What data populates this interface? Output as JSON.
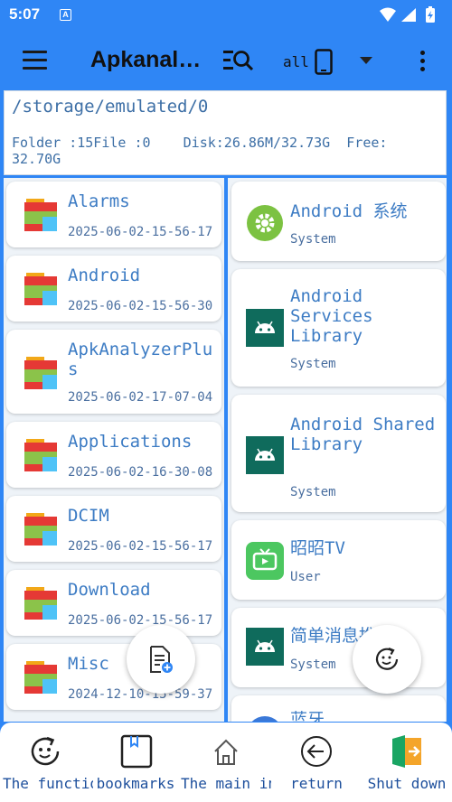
{
  "status_bar": {
    "time": "5:07",
    "notification_glyph": "A"
  },
  "app_bar": {
    "title": "Apkanaly…",
    "filter_label": "all"
  },
  "path_box": {
    "path": "/storage/emulated/0",
    "info": "Folder :15File :0    Disk:26.86M/32.73G  Free:\n32.70G"
  },
  "folders": [
    {
      "name": "Alarms",
      "date": "2025-06-02-15-56-17"
    },
    {
      "name": "Android",
      "date": "2025-06-02-15-56-30"
    },
    {
      "name": "ApkAnalyzerPlus",
      "date": "2025-06-02-17-07-04"
    },
    {
      "name": "Applications",
      "date": "2025-06-02-16-30-08"
    },
    {
      "name": "DCIM",
      "date": "2025-06-02-15-56-17"
    },
    {
      "name": "Download",
      "date": "2025-06-02-15-56-17"
    },
    {
      "name": "Misc",
      "date": "2024-12-10-15-59-37"
    }
  ],
  "apps": [
    {
      "name": "Android 系统",
      "type": "System",
      "icon": "settings-gear-icon"
    },
    {
      "name": "Android Services Library",
      "type": "System",
      "icon": "android-icon"
    },
    {
      "name": "Android Shared Library",
      "type": "System",
      "icon": "android-icon"
    },
    {
      "name": "昭昭TV",
      "type": "User",
      "icon": "tv-icon"
    },
    {
      "name": "简单消息推送",
      "type": "System",
      "icon": "android-icon"
    },
    {
      "name": "蓝牙",
      "type": "",
      "icon": "bluetooth-icon"
    }
  ],
  "bottom_nav": [
    {
      "label": "The functions",
      "icon": "face-refresh-icon"
    },
    {
      "label": "bookmarks",
      "icon": "bookmark-icon"
    },
    {
      "label": "The main interface",
      "icon": "home-icon"
    },
    {
      "label": "return",
      "icon": "back-arrow-icon"
    },
    {
      "label": "Shut down",
      "icon": "exit-door-icon"
    }
  ],
  "colors": {
    "primary": "#2f86f5",
    "text_blue": "#3d7cc4",
    "nav_text": "#1d4f9c",
    "android_green": "#0f6b5c"
  }
}
